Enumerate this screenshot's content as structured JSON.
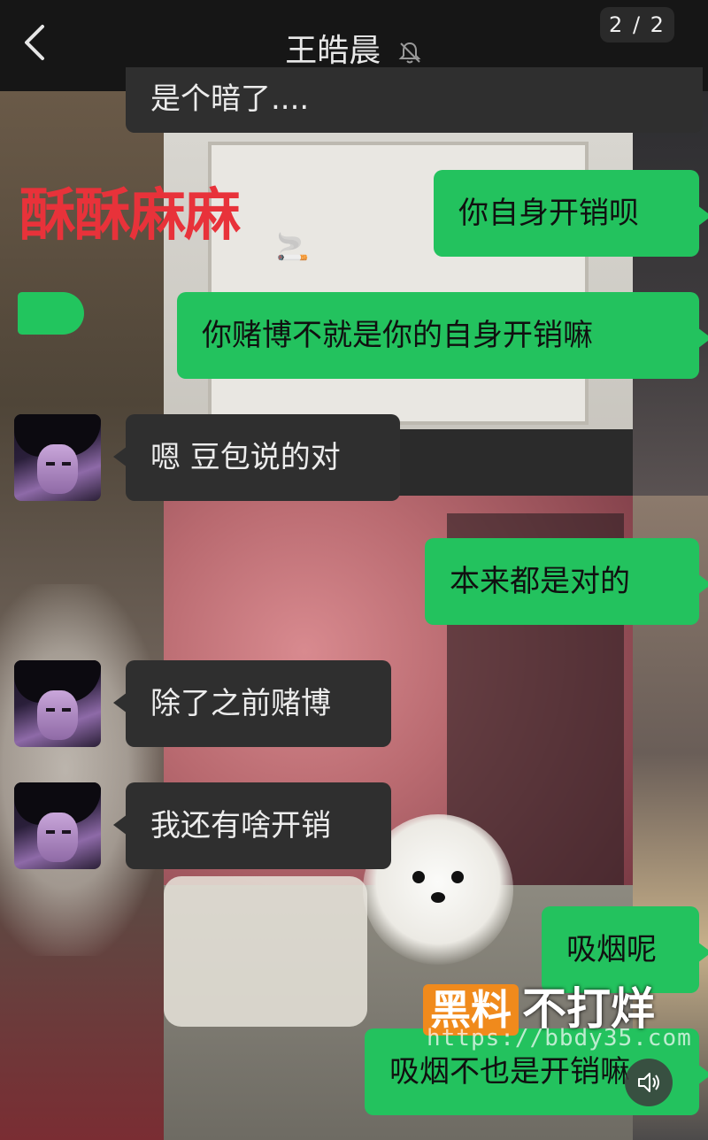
{
  "header": {
    "back_label": "back",
    "title": "王皓晨",
    "pager": "2 / 2"
  },
  "overlay": {
    "caption": "酥酥麻麻"
  },
  "messages": [
    {
      "side": "other",
      "text": "是个暗了....",
      "partial": true
    },
    {
      "side": "mine",
      "text": "你自身开销呗"
    },
    {
      "side": "mine",
      "text": "你赌博不就是你的自身开销嘛"
    },
    {
      "side": "other",
      "text": "嗯 豆包说的对"
    },
    {
      "side": "mine",
      "text": "本来都是对的"
    },
    {
      "side": "other",
      "text": "除了之前赌博"
    },
    {
      "side": "other",
      "text": "我还有啥开销"
    },
    {
      "side": "mine",
      "text": "吸烟呢"
    },
    {
      "side": "mine",
      "text": "吸烟不也是开销嘛"
    }
  ],
  "watermark": {
    "brand_box": "黑料",
    "brand_rest": "不打烊",
    "url": "https://bbdy35.com"
  },
  "colors": {
    "header_bg": "#161616",
    "bubble_mine": "#23c25e",
    "bubble_other": "#2f2f2f",
    "caption": "#e8323a",
    "watermark_box": "#f08a1c"
  },
  "icons": [
    "back-chevron-icon",
    "mute-bell-icon",
    "speaker-icon",
    "avatar"
  ]
}
